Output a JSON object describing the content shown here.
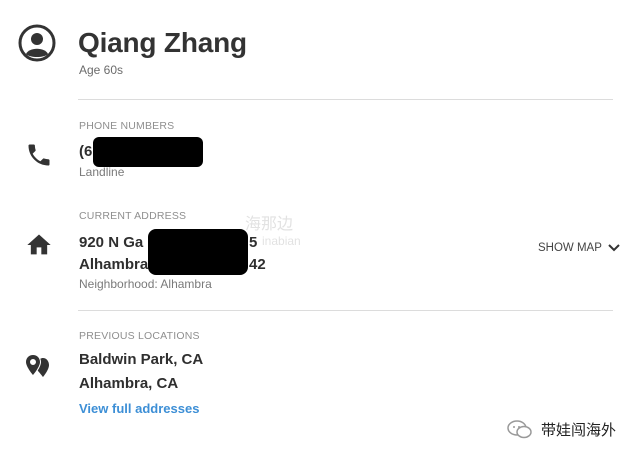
{
  "profile": {
    "name": "Qiang Zhang",
    "age": "Age 60s"
  },
  "phone": {
    "label": "PHONE NUMBERS",
    "number_visible": "(6",
    "type": "Landline"
  },
  "address": {
    "label": "CURRENT ADDRESS",
    "line1_visible": "920 N Ga",
    "line1_tail": "5",
    "line2_visible": "Alhambra C",
    "line2_tail": "42",
    "neighborhood": "Neighborhood: Alhambra",
    "show_map": "SHOW MAP"
  },
  "previous": {
    "label": "PREVIOUS LOCATIONS",
    "items": [
      "Baldwin Park, CA",
      "Alhambra, CA"
    ],
    "link": "View full addresses"
  },
  "watermark": {
    "text": "带娃闯海外",
    "faint": "海那边",
    "faint_latin": "inabian"
  },
  "icons": {
    "avatar": "account-circle-icon",
    "phone": "phone-icon",
    "home": "home-icon",
    "locations": "map-pins-icon",
    "chevron": "chevron-down-icon",
    "wechat": "wechat-icon"
  },
  "colors": {
    "link": "#3d8fd6",
    "icon": "#333333",
    "divider": "#dcdcdc"
  }
}
